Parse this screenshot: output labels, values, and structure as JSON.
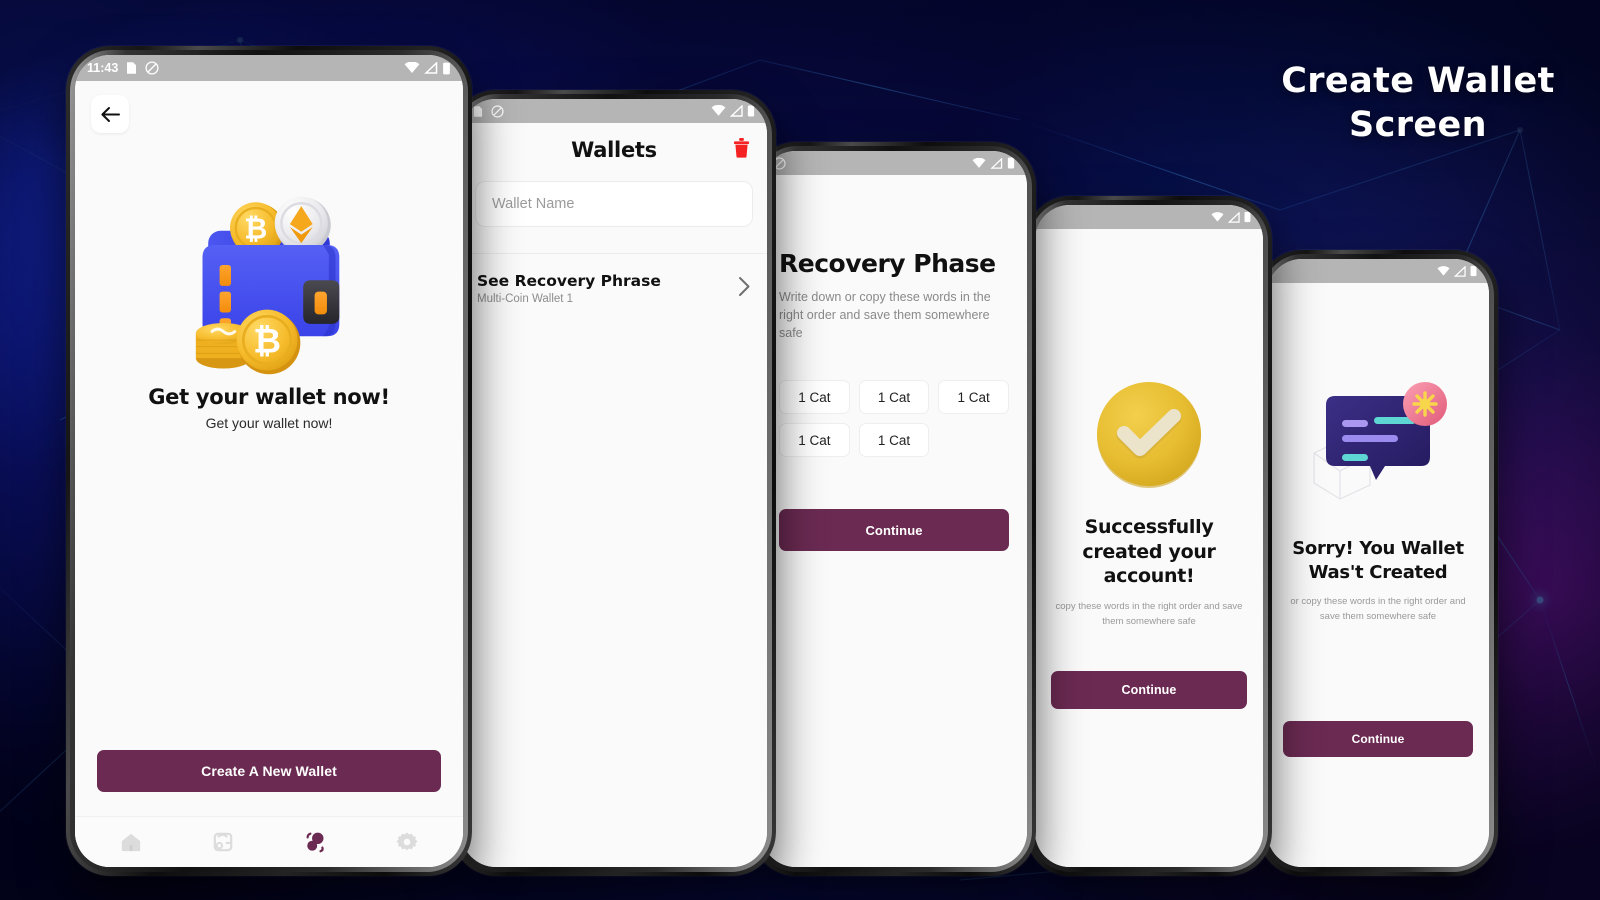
{
  "heading": {
    "line1": "Create Wallet",
    "line2": "Screen"
  },
  "theme": {
    "accent": "#6B2A52",
    "background_dark": "#080a45",
    "background_blue": "#1e3cff",
    "status_bar": "#b5b5b5",
    "screen_bg": "#fafafa",
    "trash_red": "#f42222"
  },
  "status_bar": {
    "time": "11:43",
    "left_icons": [
      "sim-card-icon",
      "do-not-disturb-icon"
    ],
    "right_icons": [
      "wifi-icon",
      "signal-icon",
      "battery-icon"
    ]
  },
  "screen1": {
    "name": "get-wallet-screen",
    "back_icon": "arrow-left-icon",
    "illustration": "wallet-with-coins-3d",
    "title": "Get your wallet now!",
    "subtitle": "Get your wallet now!",
    "cta_label": "Create A New Wallet",
    "tabs": [
      {
        "name": "home",
        "icon": "home-icon",
        "active": false
      },
      {
        "name": "wallet",
        "icon": "wallet-icon",
        "active": false
      },
      {
        "name": "tokens",
        "icon": "atom-icon",
        "active": true
      },
      {
        "name": "settings",
        "icon": "gear-icon",
        "active": false
      }
    ]
  },
  "screen2": {
    "name": "wallets-screen",
    "title": "Wallets",
    "delete_icon": "trash-icon",
    "input_placeholder": "Wallet Name",
    "input_value": "",
    "list": [
      {
        "title": "See Recovery Phrase",
        "subtitle": "Multi-Coin Wallet 1",
        "chevron": "chevron-right-icon"
      }
    ]
  },
  "screen3": {
    "name": "recovery-phase-screen",
    "title": "Recovery Phase",
    "subtitle": "Write down or copy these words in the right order and save them somewhere safe",
    "words": [
      "1 Cat",
      "1 Cat",
      "1 Cat",
      "1 Cat",
      "1 Cat"
    ],
    "cta_label": "Continue"
  },
  "screen4": {
    "name": "account-created-screen",
    "illustration": "check-circle-3d",
    "title": "Successfully created your account!",
    "subtitle": "copy these words in the right order and save them somewhere safe",
    "cta_label": "Continue"
  },
  "screen5": {
    "name": "wallet-failed-screen",
    "illustration": "error-chat-bubble-3d",
    "title": "Sorry! You Wallet Was't Created",
    "subtitle": "or copy these words in the right order and save them somewhere safe",
    "cta_label": "Continue"
  }
}
